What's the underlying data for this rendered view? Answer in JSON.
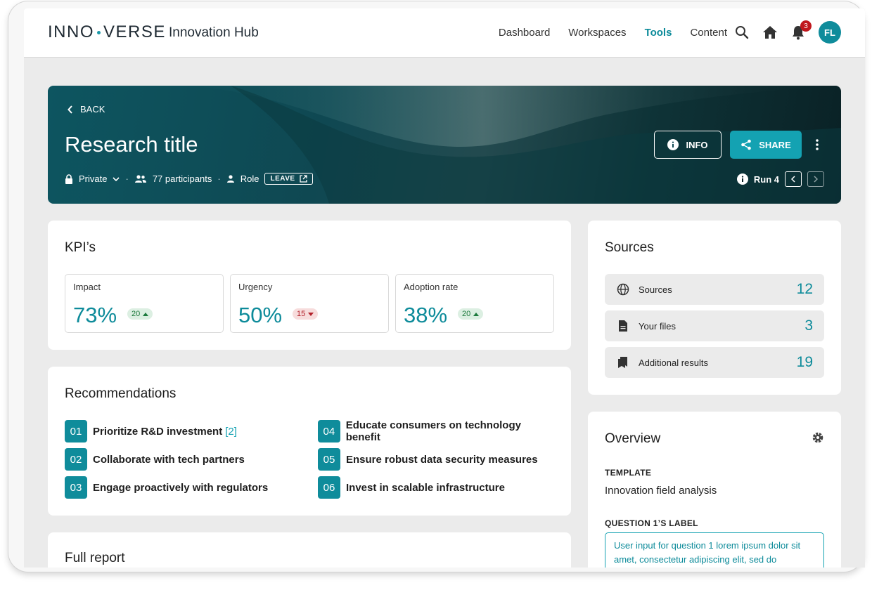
{
  "app": {
    "logo_left": "INNO",
    "logo_right": "VERSE",
    "title": "Innovation Hub"
  },
  "nav": {
    "items": [
      "Dashboard",
      "Workspaces",
      "Tools",
      "Content"
    ],
    "active": "Tools",
    "notification_count": "3",
    "avatar_initials": "FL"
  },
  "hero": {
    "back_label": "BACK",
    "title": "Research title",
    "privacy": "Private",
    "participants": "77 participants",
    "role": "Role",
    "leave_label": "LEAVE",
    "info_label": "INFO",
    "share_label": "SHARE",
    "run_label": "Run 4"
  },
  "kpis": {
    "heading": "KPI’s",
    "items": [
      {
        "label": "Impact",
        "value": "73%",
        "change": "20",
        "direction": "up"
      },
      {
        "label": "Urgency",
        "value": "50%",
        "change": "15",
        "direction": "down"
      },
      {
        "label": "Adoption rate",
        "value": "38%",
        "change": "20",
        "direction": "up"
      }
    ]
  },
  "recommendations": {
    "heading": "Recommendations",
    "items": [
      {
        "num": "01",
        "text": "Prioritize R&D investment",
        "ref": "[2]"
      },
      {
        "num": "02",
        "text": "Collaborate with tech partners",
        "ref": ""
      },
      {
        "num": "03",
        "text": "Engage proactively with regulators",
        "ref": ""
      },
      {
        "num": "04",
        "text": "Educate consumers on technology benefit",
        "ref": ""
      },
      {
        "num": "05",
        "text": "Ensure robust data security measures",
        "ref": ""
      },
      {
        "num": "06",
        "text": "Invest in scalable infrastructure",
        "ref": ""
      }
    ]
  },
  "report": {
    "heading": "Full report"
  },
  "sources": {
    "heading": "Sources",
    "items": [
      {
        "icon": "globe-icon",
        "label": "Sources",
        "count": "12"
      },
      {
        "icon": "file-icon",
        "label": "Your files",
        "count": "3"
      },
      {
        "icon": "bookmarks-icon",
        "label": "Additional results",
        "count": "19"
      }
    ]
  },
  "overview": {
    "heading": "Overview",
    "template_label": "TEMPLATE",
    "template_value": "Innovation field analysis",
    "question_label": "QUESTION 1’S LABEL",
    "question_value": "User input for question 1 lorem ipsum dolor sit amet, consectetur adipiscing elit, sed do"
  },
  "colors": {
    "accent": "#0f8c9b",
    "up": "#1d7a3d",
    "down": "#b2202a"
  }
}
